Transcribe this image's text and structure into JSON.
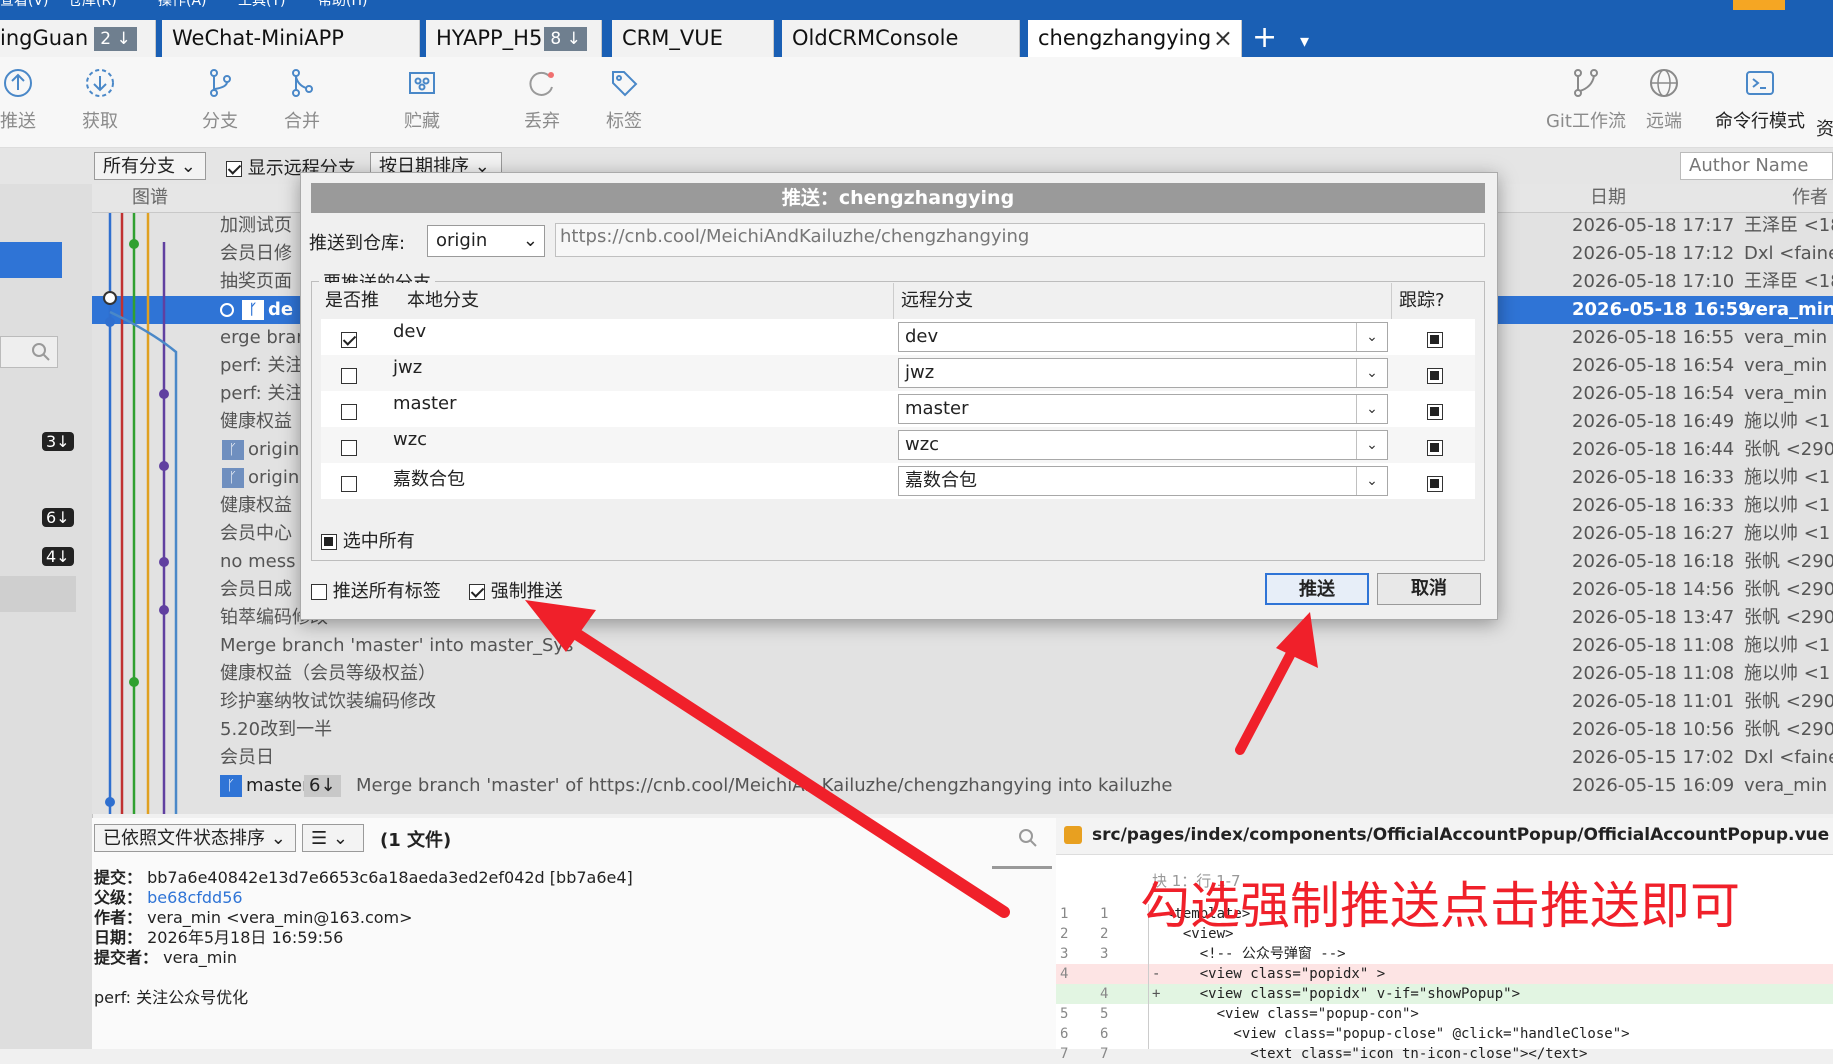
{
  "menubar": {
    "items": [
      "查看(V)",
      "仓库(R)",
      "操作(A)",
      "工具(T)",
      "帮助(H)"
    ]
  },
  "tabs": [
    {
      "label": "ingGuan",
      "badge": "2 ↓"
    },
    {
      "label": "WeChat-MiniAPP",
      "badge": ""
    },
    {
      "label": "HYAPP_H5",
      "badge": "8 ↓"
    },
    {
      "label": "CRM_VUE",
      "badge": ""
    },
    {
      "label": "OldCRMConsole",
      "badge": ""
    },
    {
      "label": "chengzhangying",
      "badge": ""
    }
  ],
  "tab_close": "×",
  "tab_add": "+",
  "tab_more": "▾",
  "toolbar": {
    "push": "推送",
    "fetch": "获取",
    "branch": "分支",
    "merge": "合并",
    "stash": "贮藏",
    "discard": "丢弃",
    "tag": "标签",
    "gitflow": "Git工作流",
    "remote": "远端",
    "terminal": "命令行模式",
    "extra": "资"
  },
  "filterbar": {
    "branches": "所有分支",
    "show_remote": "显示远程分支",
    "sort": "按日期排序",
    "author_placeholder": "Author Name"
  },
  "log_header": {
    "graph": "图谱",
    "date": "日期",
    "author": "作者"
  },
  "commits": [
    {
      "msg": "加测试页",
      "date": "2026-05-18 17:17",
      "author": "王泽臣 <18"
    },
    {
      "msg": "会员日修",
      "date": "2026-05-18 17:12",
      "author": "Dxl <faine"
    },
    {
      "msg": "抽奖页面",
      "date": "2026-05-18 17:10",
      "author": "王泽臣 <18"
    },
    {
      "msg": "de",
      "date": "2026-05-18 16:59",
      "author": "vera_min"
    },
    {
      "msg": "erge bran",
      "date": "2026-05-18 16:55",
      "author": "vera_min <"
    },
    {
      "msg": "perf: 关注",
      "date": "2026-05-18 16:54",
      "author": "vera_min <"
    },
    {
      "msg": "perf: 关注",
      "date": "2026-05-18 16:54",
      "author": "vera_min <"
    },
    {
      "msg": "健康权益",
      "date": "2026-05-18 16:49",
      "author": "施以帅 <1"
    },
    {
      "msg": "origin",
      "date": "2026-05-18 16:44",
      "author": "张帆 <290"
    },
    {
      "msg": "origin",
      "date": "2026-05-18 16:33",
      "author": "施以帅 <1"
    },
    {
      "msg": "健康权益",
      "date": "2026-05-18 16:33",
      "author": "施以帅 <1"
    },
    {
      "msg": "会员中心",
      "date": "2026-05-18 16:27",
      "author": "施以帅 <1"
    },
    {
      "msg": "no mess",
      "date": "2026-05-18 16:18",
      "author": "张帆 <290"
    },
    {
      "msg": "会员日成",
      "date": "2026-05-18 14:56",
      "author": "张帆 <290"
    },
    {
      "msg": "铂萃编码修改",
      "date": "2026-05-18 13:47",
      "author": "张帆 <290"
    },
    {
      "msg": "Merge branch 'master' into master_Sys",
      "date": "2026-05-18 11:08",
      "author": "施以帅 <1"
    },
    {
      "msg": "健康权益（会员等级权益）",
      "date": "2026-05-18 11:08",
      "author": "施以帅 <1"
    },
    {
      "msg": "珍护塞纳牧试饮装编码修改",
      "date": "2026-05-18 11:01",
      "author": "张帆 <290"
    },
    {
      "msg": "5.20改到一半",
      "date": "2026-05-18 10:56",
      "author": "张帆 <290"
    },
    {
      "msg": "会员日",
      "date": "2026-05-15 17:02",
      "author": "Dxl <faine"
    },
    {
      "msg": "Merge branch 'master' of https://cnb.cool/MeichiAn  Kailuzhe/chengzhangying into kailuzhe",
      "date": "2026-05-15 16:09",
      "author": "vera_min <"
    }
  ],
  "master_label": "master",
  "master_badge": "6↓",
  "left_badges": [
    "3↓",
    "6↓",
    "4↓"
  ],
  "bottom": {
    "sort": "已依照文件状态排序",
    "list_mode": "☰",
    "files": "(1 文件)",
    "commit_label": "提交：",
    "commit_value": "bb7a6e40842e13d7e6653c6a18aeda3ed2ef042d [bb7a6e4]",
    "parent_label": "父级：",
    "parent_value": "be68cfdd56",
    "author_label": "作者：",
    "author_value": "vera_min <vera_min@163.com>",
    "date_label": "日期：",
    "date_value": "2026年5月18日 16:59:56",
    "committer_label": "提交者：",
    "committer_value": "vera_min",
    "message": "perf: 关注公众号优化",
    "diff_path": "src/pages/index/components/OfficialAccountPopup/OfficialAccountPopup.vue",
    "hunk": "块 1：行 1-7",
    "diff_lines": [
      {
        "a": "1",
        "b": "1",
        "sign": "",
        "text": "<template>"
      },
      {
        "a": "2",
        "b": "2",
        "sign": "",
        "text": "  <view>"
      },
      {
        "a": "3",
        "b": "3",
        "sign": "",
        "text": "    <!-- 公众号弹窗 -->"
      },
      {
        "a": "4",
        "b": "",
        "sign": "-",
        "text": "    <view class=\"popidx\" >"
      },
      {
        "a": "",
        "b": "4",
        "sign": "+",
        "text": "    <view class=\"popidx\" v-if=\"showPopup\">"
      },
      {
        "a": "5",
        "b": "5",
        "sign": "",
        "text": "      <view class=\"popup-con\">"
      },
      {
        "a": "6",
        "b": "6",
        "sign": "",
        "text": "        <view class=\"popup-close\" @click=\"handleClose\">"
      },
      {
        "a": "7",
        "b": "7",
        "sign": "",
        "text": "          <text class=\"icon tn-icon-close\"></text>"
      }
    ]
  },
  "dialog": {
    "title": "推送：chengzhangying",
    "repo_label": "推送到仓库:",
    "repo_value": "origin",
    "repo_url": "https://cnb.cool/MeichiAndKailuzhe/chengzhangying",
    "branches_group": "要推送的分支",
    "col_push": "是否推",
    "col_local": "本地分支",
    "col_remote": "远程分支",
    "col_track": "跟踪?",
    "branches": [
      {
        "checked": true,
        "local": "dev",
        "remote": "dev"
      },
      {
        "checked": false,
        "local": "jwz",
        "remote": "jwz"
      },
      {
        "checked": false,
        "local": "master",
        "remote": "master"
      },
      {
        "checked": false,
        "local": "wzc",
        "remote": "wzc"
      },
      {
        "checked": false,
        "local": "嘉数合包",
        "remote": "嘉数合包"
      }
    ],
    "select_all": "选中所有",
    "push_all_tags": "推送所有标签",
    "force_push": "强制推送",
    "ok": "推送",
    "cancel": "取消"
  },
  "annotation": "勾选强制推送点击推送即可",
  "colors": {
    "accent": "#1a5fb4",
    "selection": "#2f74d6",
    "arrow": "#f0202a"
  }
}
